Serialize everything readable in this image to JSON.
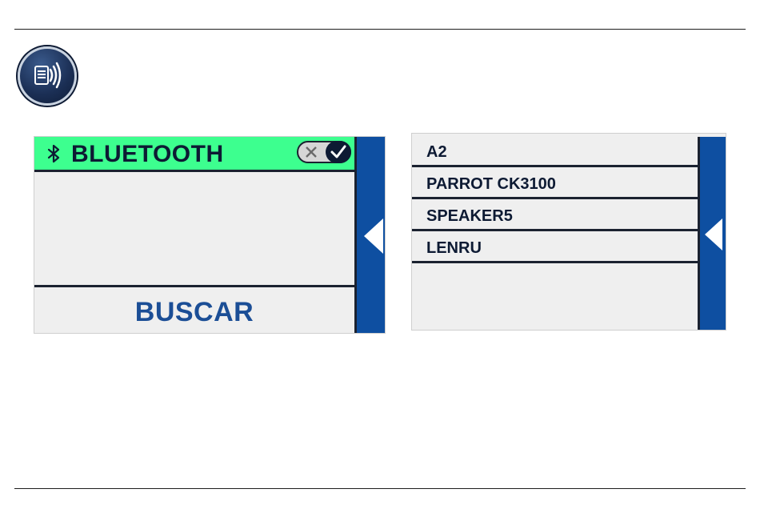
{
  "left_screen": {
    "title": "BLUETOOTH",
    "toggle_state": "on",
    "search_button": "BUSCAR",
    "colors": {
      "header_bg": "#3dff8f",
      "accent_blue": "#0e4fa1",
      "button_text": "#1b4e96"
    }
  },
  "right_screen": {
    "devices": [
      {
        "name": "A2"
      },
      {
        "name": "PARROT CK3100"
      },
      {
        "name": "SPEAKER5"
      },
      {
        "name": "LENRU"
      }
    ]
  },
  "icons": {
    "app": "document-audio-icon",
    "bluetooth": "bluetooth-icon",
    "toggle_off": "close-x-icon",
    "toggle_on": "checkmark-icon",
    "back": "back-arrow-icon"
  }
}
